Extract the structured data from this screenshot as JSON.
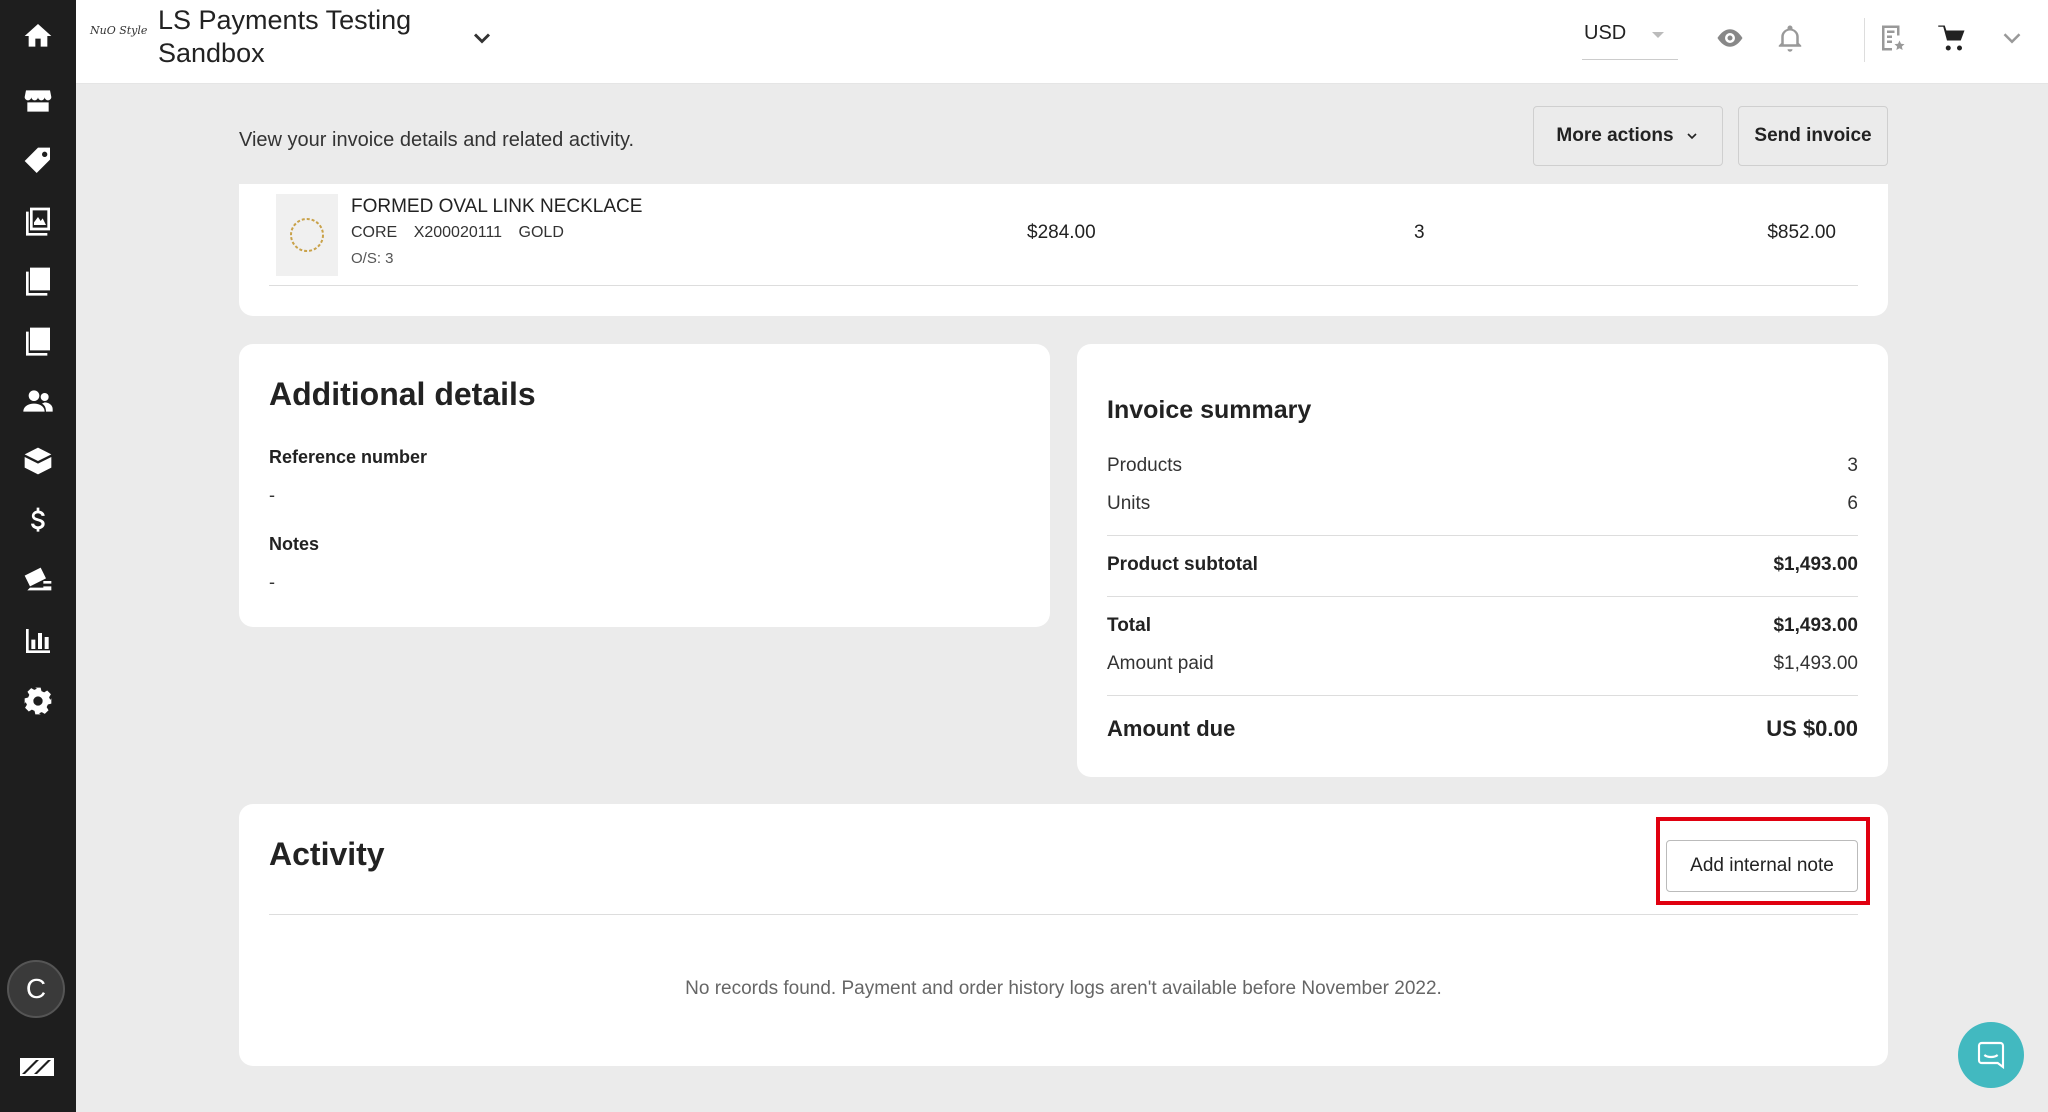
{
  "topbar": {
    "logo_text": "NuO Style",
    "store_name": "LS Payments Testing Sandbox",
    "currency": "USD"
  },
  "header": {
    "description": "View your invoice details and related activity.",
    "more_actions_label": "More actions",
    "send_invoice_label": "Send invoice"
  },
  "product": {
    "name": "FORMED OVAL LINK NECKLACE",
    "collection": "CORE",
    "sku": "X200020111",
    "color": "GOLD",
    "os": "O/S: 3",
    "price": "$284.00",
    "quantity": "3",
    "total": "$852.00"
  },
  "additional_details": {
    "title": "Additional details",
    "reference_label": "Reference number",
    "reference_value": "-",
    "notes_label": "Notes",
    "notes_value": "-"
  },
  "summary": {
    "title": "Invoice summary",
    "products_label": "Products",
    "products_value": "3",
    "units_label": "Units",
    "units_value": "6",
    "subtotal_label": "Product subtotal",
    "subtotal_value": "$1,493.00",
    "total_label": "Total",
    "total_value": "$1,493.00",
    "paid_label": "Amount paid",
    "paid_value": "$1,493.00",
    "due_label": "Amount due",
    "due_value": "US $0.00"
  },
  "activity": {
    "title": "Activity",
    "add_note_label": "Add internal note",
    "empty_message": "No records found. Payment and order history logs aren't available before November 2022."
  },
  "user": {
    "avatar_initial": "C"
  },
  "colors": {
    "sidebar_bg": "#1e1e1e",
    "band_bg": "#ebebeb",
    "highlight": "#e00010",
    "chat_accent": "#42b9c0"
  }
}
